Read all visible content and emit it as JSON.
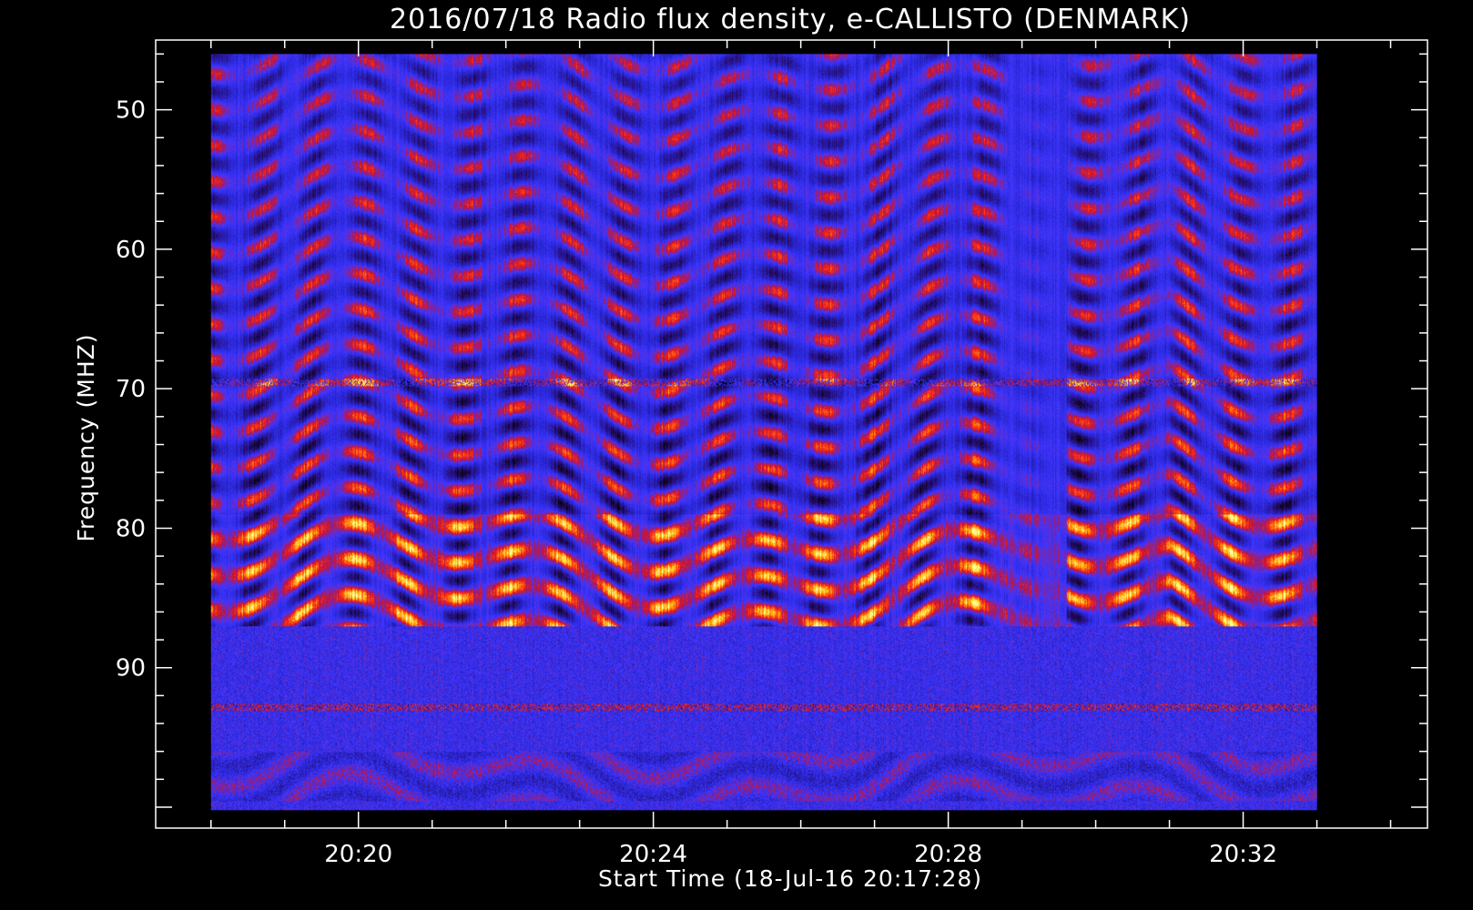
{
  "chart_data": {
    "type": "heatmap",
    "title": "2016/07/18  Radio flux density, e-CALLISTO (DENMARK)",
    "xlabel": "Start Time (18-Jul-16 20:17:28)",
    "ylabel": "Frequency (MHZ)",
    "x_ticks": [
      "20:20",
      "20:24",
      "20:28",
      "20:32"
    ],
    "x_tick_minutes": [
      20,
      24,
      28,
      32
    ],
    "y_ticks": [
      "50",
      "60",
      "70",
      "80",
      "90"
    ],
    "y_tick_values": [
      50,
      60,
      70,
      80,
      90
    ],
    "xlim_minutes": [
      17.25,
      34.5
    ],
    "ylim": [
      45,
      101.5
    ],
    "data_x_range_minutes": [
      18.0,
      33.0
    ],
    "data_y_range": [
      46,
      100.2
    ],
    "colormap": [
      "#000000",
      "#2a0f7a",
      "#2a2ae6",
      "#4b3cff",
      "#c8102e",
      "#ff3b1a",
      "#ffb000",
      "#ffff80"
    ],
    "features": [
      {
        "kind": "strong-band",
        "freq_range": [
          79,
          87
        ]
      },
      {
        "kind": "noise-band",
        "freq_range": [
          87,
          100.2
        ]
      },
      {
        "kind": "horizontal-line",
        "freq": 69.5
      },
      {
        "kind": "horizontal-line",
        "freq": 92.8
      },
      {
        "kind": "quiet-interval",
        "time_range_minutes": [
          28.8,
          29.6
        ]
      }
    ]
  }
}
